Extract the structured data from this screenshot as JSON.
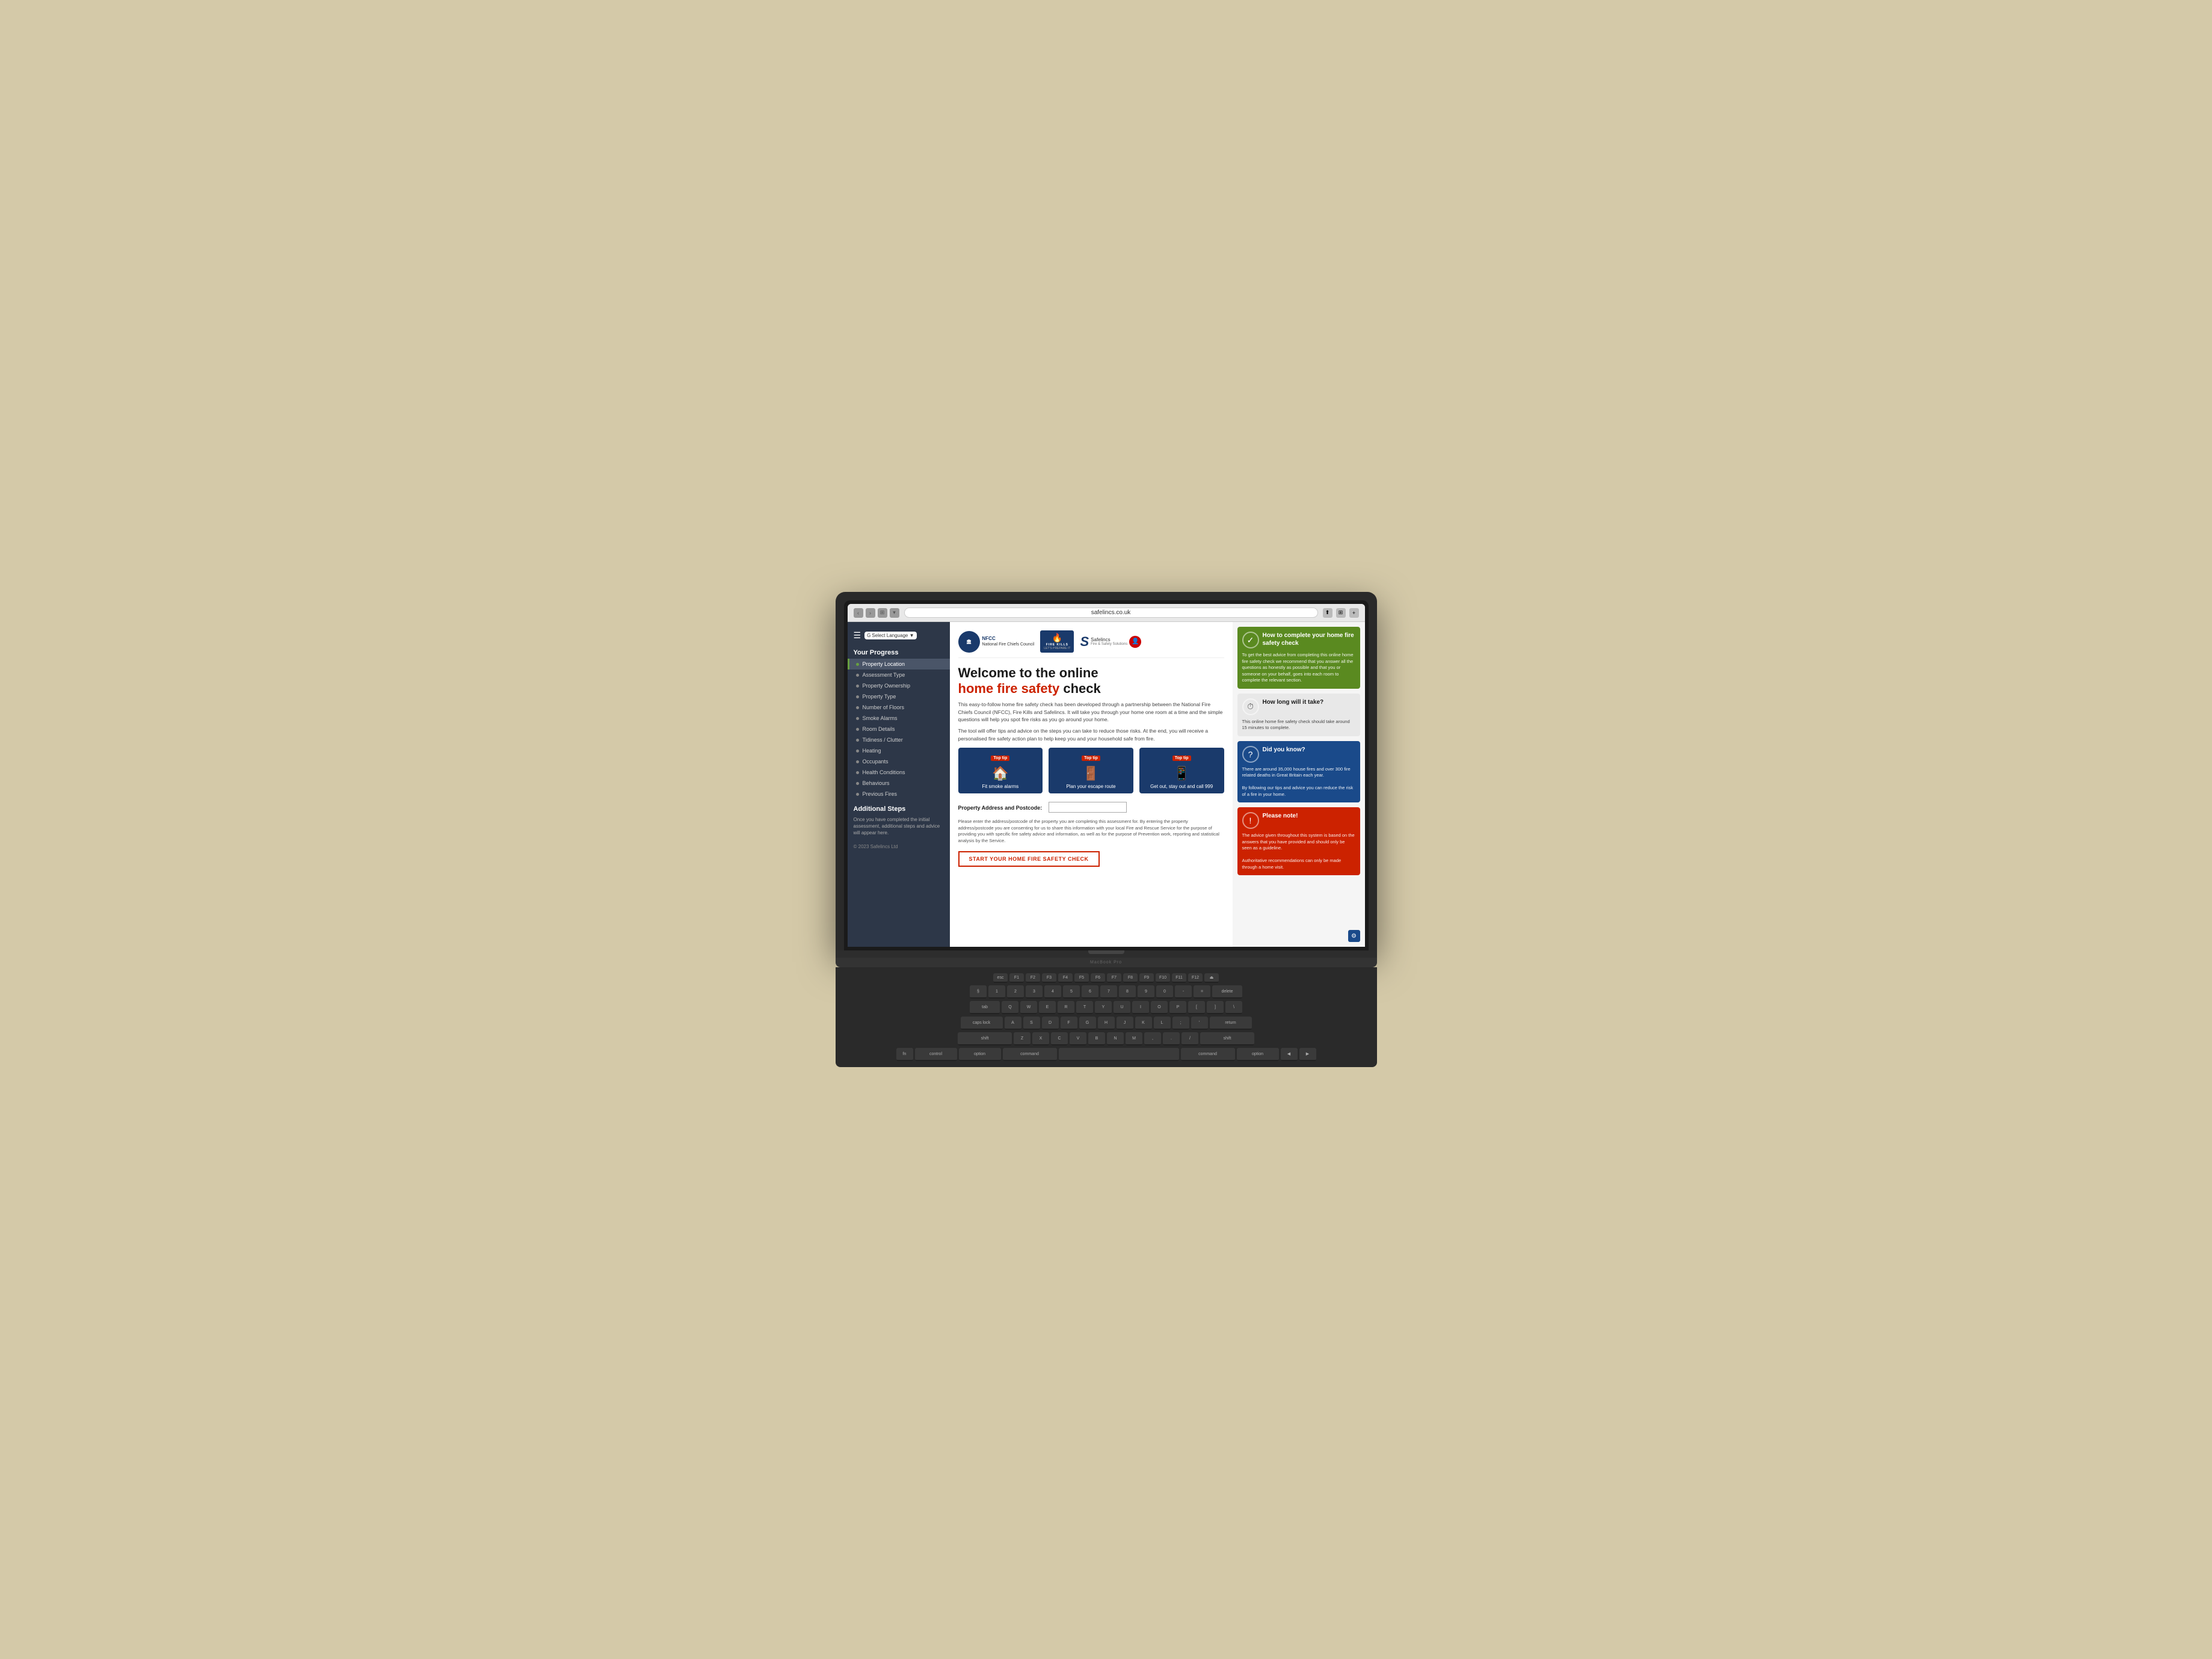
{
  "browser": {
    "url": "safelincs.co.uk",
    "back_label": "‹",
    "forward_label": "›"
  },
  "sidebar": {
    "title": "Your Progress",
    "lang_select": "Select Language ▼",
    "items": [
      {
        "label": "Property Location",
        "active": true
      },
      {
        "label": "Assessment Type",
        "active": false
      },
      {
        "label": "Property Ownership",
        "active": false
      },
      {
        "label": "Property Type",
        "active": false
      },
      {
        "label": "Number of Floors",
        "active": false
      },
      {
        "label": "Smoke Alarms",
        "active": false
      },
      {
        "label": "Room Details",
        "active": false
      },
      {
        "label": "Tidiness / Clutter",
        "active": false
      },
      {
        "label": "Heating",
        "active": false
      },
      {
        "label": "Occupants",
        "active": false
      },
      {
        "label": "Health Conditions",
        "active": false
      },
      {
        "label": "Behaviours",
        "active": false
      },
      {
        "label": "Previous Fires",
        "active": false
      }
    ],
    "additional_steps_title": "Additional Steps",
    "additional_steps_text": "Once you have completed the initial assessment, additional steps and advice will appear here.",
    "footer": "© 2023 Safelincs Ltd"
  },
  "header": {
    "nfcc_label": "NFCC",
    "nfcc_full": "National Fire Chiefs Council",
    "fire_kills_label": "FIRE KILLS",
    "fire_kills_sub": "LET'S PREPARE IT",
    "safelincs_label": "Safelincs",
    "safelincs_sub": "Fire & Safety Solutions"
  },
  "welcome": {
    "title_line1": "Welcome to the online",
    "title_line2_normal": "home fire safety",
    "title_line2_end": " check",
    "description1": "This easy-to-follow home fire safety check has been developed through a partnership between the National Fire Chiefs Council (NFCC), Fire Kills and Safelincs. It will take you through your home one room at a time and the simple questions will help you spot fire risks as you go around your home.",
    "description2": "The tool will offer tips and advice on the steps you can take to reduce those risks. At the end, you will receive a personalised fire safety action plan to help keep you and your household safe from fire."
  },
  "top_tips": [
    {
      "badge": "Top tip",
      "icon": "🏠",
      "label": "Fit smoke alarms"
    },
    {
      "badge": "Top tip",
      "icon": "🚪",
      "label": "Plan your escape route"
    },
    {
      "badge": "Top tip",
      "icon": "📱",
      "label": "Get out, stay out and call 999"
    }
  ],
  "address": {
    "label": "Property Address and Postcode:",
    "description": "Please enter the address/postcode of the property you are completing this assessment for. By entering the property address/postcode you are consenting for us to share this information with your local Fire and Rescue Service for the purpose of providing you with specific fire safety advice and information, as well as for the purpose of Prevention work, reporting and statistical analysis by the Service."
  },
  "start_button": {
    "label": "START YOUR HOME FIRE SAFETY CHECK"
  },
  "info_cards": [
    {
      "type": "green",
      "icon": "✓",
      "title": "How to complete your home fire safety check",
      "body": "To get the best advice from completing this online home fire safety check we recommend that you answer all the questions as honestly as possible and that you or someone on your behalf, goes into each room to complete the relevant section."
    },
    {
      "type": "gray",
      "icon": "⏱",
      "title": "How long will it take?",
      "body": "This online home fire safety check should take around 15 minutes to complete."
    },
    {
      "type": "blue",
      "icon": "?",
      "title": "Did you know?",
      "body": "There are around 35,000 house fires and over 300 fire related deaths in Great Britain each year.\n\nBy following our tips and advice you can reduce the risk of a fire in your home."
    },
    {
      "type": "red",
      "icon": "!",
      "title": "Please note!",
      "body": "The advice given throughout this system is based on the answers that you have provided and should only be seen as a guideline.\n\nAuthoritative recommendations can only be made through a home visit."
    }
  ],
  "settings_icon": "⚙"
}
